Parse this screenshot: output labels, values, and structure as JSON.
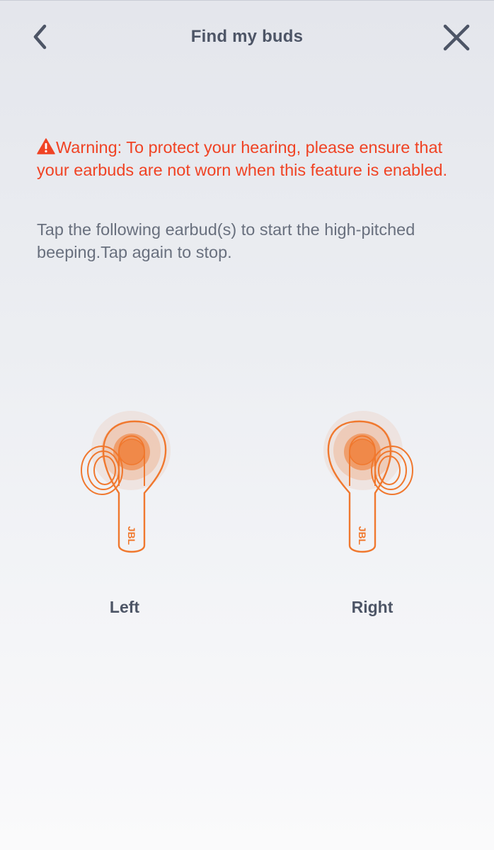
{
  "header": {
    "title": "Find my buds"
  },
  "warning": {
    "text": "Warning: To protect your hearing, please ensure that your earbuds are not worn when this feature is enabled."
  },
  "instructions": {
    "text": "Tap the following earbud(s) to start the high-pitched beeping.Tap again to stop."
  },
  "earbuds": [
    {
      "label": "Left",
      "brand": "JBL"
    },
    {
      "label": "Right",
      "brand": "JBL"
    }
  ],
  "colors": {
    "accent": "#f0782e",
    "warning": "#f04324",
    "title": "#4d5566",
    "body_text": "#69707e"
  },
  "icons": {
    "back": "chevron-left-icon",
    "close": "close-icon",
    "warning": "warning-triangle-icon"
  }
}
